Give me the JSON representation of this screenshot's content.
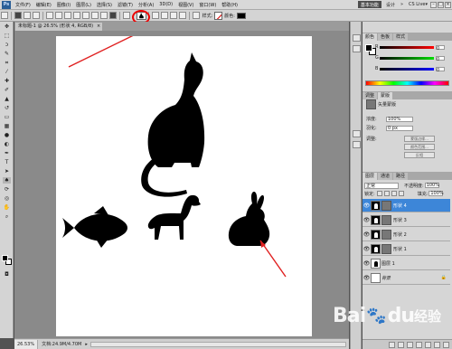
{
  "menubar": {
    "logo": "Ps",
    "items": [
      "文件(F)",
      "编辑(E)",
      "图像(I)",
      "图层(L)",
      "选择(S)",
      "滤镜(T)",
      "分析(A)",
      "3D(D)",
      "视图(V)",
      "窗口(W)",
      "帮助(H)"
    ],
    "workspace_button": "基本功能",
    "workspace_link": "设计",
    "workspace_more": "»",
    "cs_live": "CS Live▾",
    "window_buttons": [
      "–",
      "□",
      "×"
    ]
  },
  "optbar": {
    "style_label": "样式:",
    "color_label": "颜色:",
    "shape_icon": "rabbit-shape-icon",
    "highlight_color": "#e00000"
  },
  "document": {
    "tab_title": "未标题-1 @ 26.5% (形状 4, RGB/8)",
    "tab_close": "×",
    "zoom": "26.53%",
    "doc_info": "文档:24.9M/4.70M",
    "status_arrow": "▸"
  },
  "color_panel": {
    "tabs": [
      "颜色",
      "色板",
      "样式"
    ],
    "channels": [
      {
        "name": "R",
        "value": "0"
      },
      {
        "name": "G",
        "value": "0"
      },
      {
        "name": "B",
        "value": "0"
      }
    ]
  },
  "adjust_panel": {
    "tabs": [
      "调整",
      "蒙版"
    ],
    "mask_label": "矢量蒙版",
    "density_label": "浓度:",
    "density_value": "100%",
    "feather_label": "羽化:",
    "feather_value": "0 px",
    "refine_label": "调整:",
    "btn_mask_edge": "蒙版边缘...",
    "btn_color_range": "颜色范围...",
    "btn_invert": "反相"
  },
  "layers_panel": {
    "tabs": [
      "图层",
      "通道",
      "路径"
    ],
    "blend_mode": "正常",
    "opacity_label": "不透明度:",
    "opacity_value": "100%",
    "lock_label": "锁定:",
    "fill_label": "填充:",
    "fill_value": "100%",
    "layers": [
      {
        "name": "形状 4",
        "selected": true,
        "thumb": "shape"
      },
      {
        "name": "形状 3",
        "selected": false,
        "thumb": "shape"
      },
      {
        "name": "形状 2",
        "selected": false,
        "thumb": "shape"
      },
      {
        "name": "形状 1",
        "selected": false,
        "thumb": "shape"
      },
      {
        "name": "图层 1",
        "selected": false,
        "thumb": "plain"
      },
      {
        "name": "背景",
        "selected": false,
        "thumb": "plain"
      }
    ]
  },
  "annotation": {
    "arrow_color": "#e02020"
  },
  "watermark": {
    "text_en": "Bai",
    "text_paw": "du",
    "text_cn": "经验"
  }
}
